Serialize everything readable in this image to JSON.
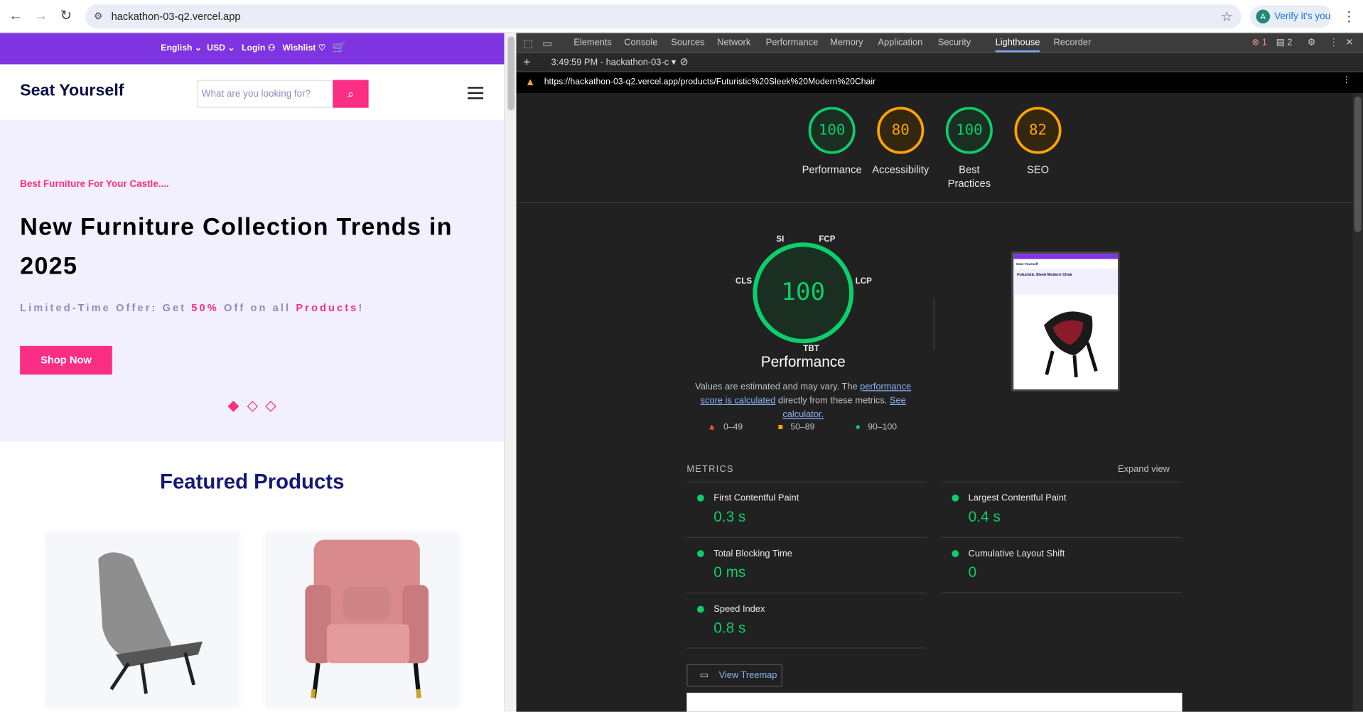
{
  "browser": {
    "url": "hackathon-03-q2.vercel.app",
    "verify_label": "Verify it's you",
    "avatar_letter": "A"
  },
  "site": {
    "topbar": {
      "language": "English",
      "currency": "USD",
      "login": "Login",
      "wishlist": "Wishlist"
    },
    "logo": "Seat Yourself",
    "search_placeholder": "What are you looking for?",
    "hero": {
      "subtitle": "Best Furniture For Your Castle....",
      "title": "New Furniture Collection Trends in 2025",
      "offer_prefix": "Limited-Time Offer: Get",
      "offer_percent": "50%",
      "offer_middle": "Off on all",
      "offer_products": "Products",
      "offer_suffix": "!",
      "button": "Shop Now"
    },
    "featured_title": "Featured Products"
  },
  "devtools": {
    "tabs": [
      "Elements",
      "Console",
      "Sources",
      "Network",
      "Performance",
      "Memory",
      "Application",
      "Security",
      "Lighthouse",
      "Recorder"
    ],
    "active_tab": "Lighthouse",
    "errors": "1",
    "messages": "2",
    "report_select": "3:49:59 PM - hackathon-03-c",
    "report_url": "https://hackathon-03-q2.vercel.app/products/Futuristic%20Sleek%20Modern%20Chair"
  },
  "lighthouse": {
    "scores": [
      {
        "label": "Performance",
        "value": "100",
        "status": "green"
      },
      {
        "label": "Accessibility",
        "value": "80",
        "status": "orange"
      },
      {
        "label": "Best Practices",
        "value": "100",
        "status": "green"
      },
      {
        "label": "SEO",
        "value": "82",
        "status": "orange"
      }
    ],
    "gauge_value": "100",
    "gauge_labels": {
      "si": "SI",
      "fcp": "FCP",
      "cls": "CLS",
      "lcp": "LCP",
      "tbt": "TBT"
    },
    "perf_title": "Performance",
    "note_prefix": "Values are estimated and may vary. The",
    "note_link1": "performance score is calculated",
    "note_middle": "directly from these metrics.",
    "note_link2": "See calculator.",
    "legend": [
      "0–49",
      "50–89",
      "90–100"
    ],
    "metrics_title": "METRICS",
    "expand_view": "Expand view",
    "metrics": [
      {
        "label": "First Contentful Paint",
        "value": "0.3 s"
      },
      {
        "label": "Largest Contentful Paint",
        "value": "0.4 s"
      },
      {
        "label": "Total Blocking Time",
        "value": "0 ms"
      },
      {
        "label": "Cumulative Layout Shift",
        "value": "0"
      },
      {
        "label": "Speed Index",
        "value": "0.8 s"
      }
    ],
    "treemap_button": "View Treemap",
    "screenshot_title": "Futuristic Sleek Modern Chair"
  },
  "colors": {
    "brand_purple": "#7f34e1",
    "brand_pink": "#fb2e86",
    "lh_green": "#0cce6b",
    "lh_orange": "#ffa400",
    "lh_red": "#ff4e42"
  }
}
